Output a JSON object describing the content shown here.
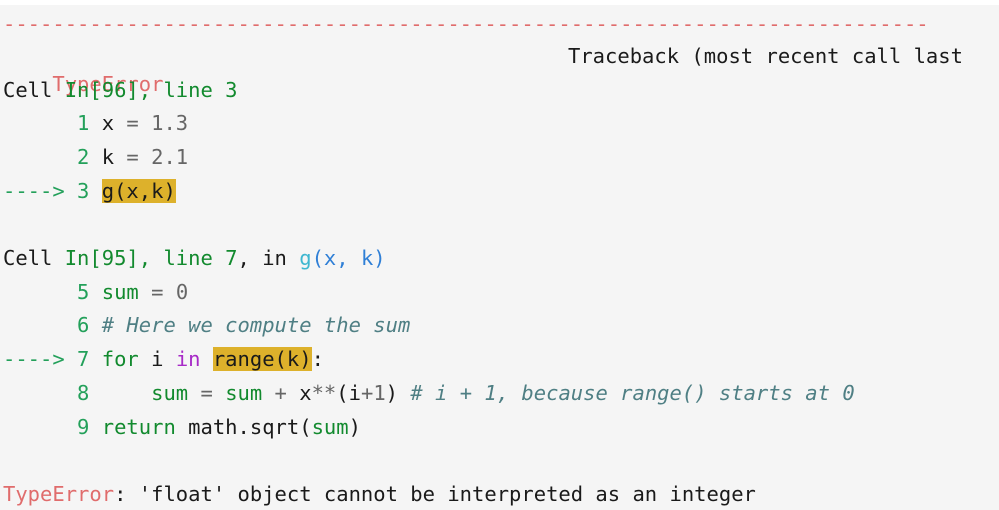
{
  "traceback": {
    "separator": "---------------------------------------------------------------------------",
    "error_type": "TypeError",
    "header_right": "Traceback (most recent call last",
    "frame1": {
      "cell_prefix": "Cell ",
      "cell_ref": "In[96], line 3",
      "lines": [
        {
          "num": "      1 ",
          "code_a": "x",
          "code_op": " = ",
          "code_val": "1.3"
        },
        {
          "num": "      2 ",
          "code_a": "k",
          "code_op": " = ",
          "code_val": "2.1"
        }
      ],
      "arrow": "----> 3 ",
      "arrow_code": "g(x,k)"
    },
    "frame2": {
      "cell_prefix": "Cell ",
      "cell_ref": "In[95], line 7",
      "in_text": ", in ",
      "func": "g",
      "args": "(x, k)",
      "line5": {
        "num": "      5 ",
        "var": "sum",
        "op": " = ",
        "val": "0"
      },
      "line6": {
        "num": "      6 ",
        "comment": "# Here we compute the sum"
      },
      "line7": {
        "arrow": "----> 7 ",
        "kw_for": "for",
        "var": " i ",
        "kw_in": "in",
        "func": "range(k)",
        "colon": ":"
      },
      "line8": {
        "num": "      8 ",
        "indent": "    ",
        "lhs": "sum",
        "eq": " = ",
        "rhs": "sum",
        "plus": " + ",
        "x": "x",
        "pow": "**",
        "paren": "(i",
        "plus2": "+",
        "one": "1",
        "close": ") ",
        "comment": "# i + 1, because range() starts at 0"
      },
      "line9": {
        "num": "      9 ",
        "kw_return": "return",
        "call": " math.sqrt(",
        "arg": "sum",
        "close": ")"
      }
    },
    "final_error": {
      "type": "TypeError",
      "message": ": 'float' object cannot be interpreted as an integer"
    }
  }
}
